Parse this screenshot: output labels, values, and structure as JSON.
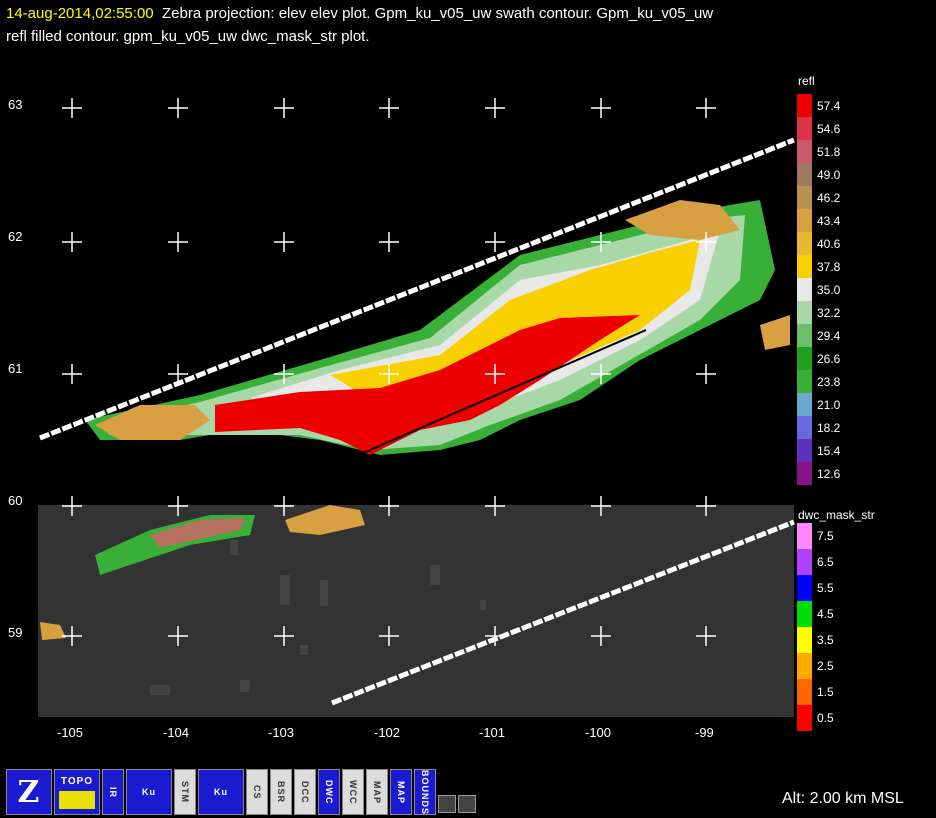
{
  "header": {
    "timestamp": "14-aug-2014,02:55:00",
    "line1_rest": "Zebra projection: elev elev  plot.  Gpm_ku_v05_uw swath contour.  Gpm_ku_v05_uw",
    "line2": "refl filled contour.  gpm_ku_v05_uw dwc_mask_str  plot."
  },
  "axes": {
    "y_ticks": [
      "63",
      "62",
      "61",
      "60",
      "59"
    ],
    "x_ticks": [
      "-105",
      "-104",
      "-103",
      "-102",
      "-101",
      "-100",
      "-99"
    ]
  },
  "refl_bar": {
    "title": "refl",
    "labels": [
      "57.4",
      "54.6",
      "51.8",
      "49.0",
      "46.2",
      "43.4",
      "40.6",
      "37.8",
      "35.0",
      "32.2",
      "29.4",
      "26.6",
      "23.8",
      "21.0",
      "18.2",
      "15.4",
      "12.6"
    ],
    "colors": [
      "#ee0000",
      "#dd3344",
      "#c85a6a",
      "#a07860",
      "#b89050",
      "#d8a040",
      "#e8b830",
      "#f8d000",
      "#e8e8e8",
      "#a8d8a8",
      "#68c068",
      "#20a020",
      "#38b038",
      "#6aa8d0",
      "#6868e0",
      "#6030c0",
      "#881088"
    ]
  },
  "dwc_bar": {
    "title": "dwc_mask_str",
    "labels": [
      "7.5",
      "6.5",
      "5.5",
      "4.5",
      "3.5",
      "2.5",
      "1.5",
      "0.5"
    ],
    "colors": [
      "#ff88ff",
      "#b040ff",
      "#0000ff",
      "#00dd00",
      "#ffff00",
      "#ffaa00",
      "#ff6600",
      "#ff0000"
    ]
  },
  "toolbar": {
    "topo_label": "TOPO",
    "stm_label": "STM",
    "bsr_label": "BSR",
    "dcc_label": "DCC",
    "dwc_label": "DWC",
    "wcc_label": "WCC",
    "map_label": "MAP",
    "bounds_label": "BOUNDS"
  },
  "status": {
    "altitude": "Alt: 2.00 km MSL"
  }
}
